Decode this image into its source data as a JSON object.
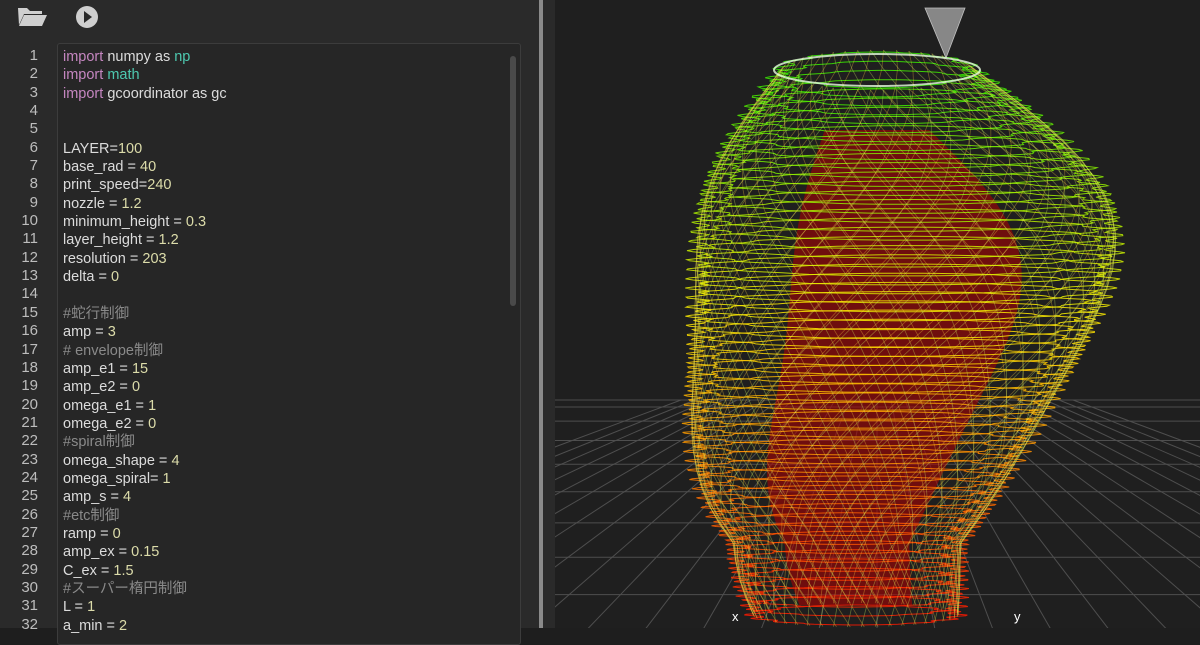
{
  "toolbar": {
    "open_icon": "folder-open-icon",
    "run_icon": "play-icon"
  },
  "editor": {
    "lines": [
      {
        "n": "1",
        "t": [
          [
            "kw",
            "import"
          ],
          [
            "",
            "numpy as "
          ],
          [
            "mod",
            "np"
          ]
        ]
      },
      {
        "n": "2",
        "t": [
          [
            "kw",
            "import"
          ],
          [
            "mod",
            " math"
          ]
        ]
      },
      {
        "n": "3",
        "t": [
          [
            "kw",
            "import"
          ],
          [
            "",
            "gcoordinator as gc"
          ]
        ]
      },
      {
        "n": "4",
        "t": []
      },
      {
        "n": "5",
        "t": []
      },
      {
        "n": "6",
        "t": [
          [
            "",
            "LAYER="
          ],
          [
            "num",
            "100"
          ]
        ]
      },
      {
        "n": "7",
        "t": [
          [
            "",
            "base_rad = "
          ],
          [
            "num",
            "40"
          ]
        ]
      },
      {
        "n": "8",
        "t": [
          [
            "",
            "print_speed="
          ],
          [
            "num",
            "240"
          ]
        ]
      },
      {
        "n": "9",
        "t": [
          [
            "",
            "nozzle = "
          ],
          [
            "num",
            "1.2"
          ]
        ]
      },
      {
        "n": "10",
        "t": [
          [
            "",
            "minimum_height = "
          ],
          [
            "num",
            "0.3"
          ]
        ]
      },
      {
        "n": "11",
        "t": [
          [
            "",
            "layer_height = "
          ],
          [
            "num",
            "1.2"
          ]
        ]
      },
      {
        "n": "12",
        "t": [
          [
            "",
            "resolution = "
          ],
          [
            "num",
            "203"
          ]
        ]
      },
      {
        "n": "13",
        "t": [
          [
            "",
            "delta = "
          ],
          [
            "num",
            "0"
          ]
        ]
      },
      {
        "n": "14",
        "t": []
      },
      {
        "n": "15",
        "t": [
          [
            "cmt",
            "#蛇行制御"
          ]
        ]
      },
      {
        "n": "16",
        "t": [
          [
            "",
            "amp = "
          ],
          [
            "num",
            "3"
          ]
        ]
      },
      {
        "n": "17",
        "t": [
          [
            "cmt",
            "# envelope制御"
          ]
        ]
      },
      {
        "n": "18",
        "t": [
          [
            "",
            "amp_e1 = "
          ],
          [
            "num",
            "15"
          ]
        ]
      },
      {
        "n": "19",
        "t": [
          [
            "",
            "amp_e2 = "
          ],
          [
            "num",
            "0"
          ]
        ]
      },
      {
        "n": "20",
        "t": [
          [
            "",
            "omega_e1 = "
          ],
          [
            "num",
            "1"
          ]
        ]
      },
      {
        "n": "21",
        "t": [
          [
            "",
            "omega_e2 = "
          ],
          [
            "num",
            "0"
          ]
        ]
      },
      {
        "n": "22",
        "t": [
          [
            "cmt",
            "#spiral制御"
          ]
        ]
      },
      {
        "n": "23",
        "t": [
          [
            "",
            "omega_shape = "
          ],
          [
            "num",
            "4"
          ]
        ]
      },
      {
        "n": "24",
        "t": [
          [
            "",
            "omega_spiral= "
          ],
          [
            "num",
            "1"
          ]
        ]
      },
      {
        "n": "25",
        "t": [
          [
            "",
            "amp_s = "
          ],
          [
            "num",
            "4"
          ]
        ]
      },
      {
        "n": "26",
        "t": [
          [
            "cmt",
            "#etc制御"
          ]
        ]
      },
      {
        "n": "27",
        "t": [
          [
            "",
            "ramp = "
          ],
          [
            "num",
            "0"
          ]
        ]
      },
      {
        "n": "28",
        "t": [
          [
            "",
            "amp_ex = "
          ],
          [
            "num",
            "0.15"
          ]
        ]
      },
      {
        "n": "29",
        "t": [
          [
            "",
            "C_ex = "
          ],
          [
            "num",
            "1.5"
          ]
        ]
      },
      {
        "n": "30",
        "t": [
          [
            "cmt",
            "#スーパー楕円制御"
          ]
        ]
      },
      {
        "n": "31",
        "t": [
          [
            "",
            "L = "
          ],
          [
            "num",
            "1"
          ]
        ]
      },
      {
        "n": "32",
        "t": [
          [
            "",
            "a_min = "
          ],
          [
            "num",
            "2"
          ]
        ]
      }
    ]
  },
  "viewer": {
    "axis_x": "x",
    "axis_y": "y",
    "colors": {
      "top": "#33ee00",
      "mid": "#ffee00",
      "low": "#ff6a00",
      "base": "#ff1a00",
      "inner": "#b00000",
      "grid": "#5a5a5a"
    },
    "nozzle_icon": "nozzle-cone-icon"
  }
}
